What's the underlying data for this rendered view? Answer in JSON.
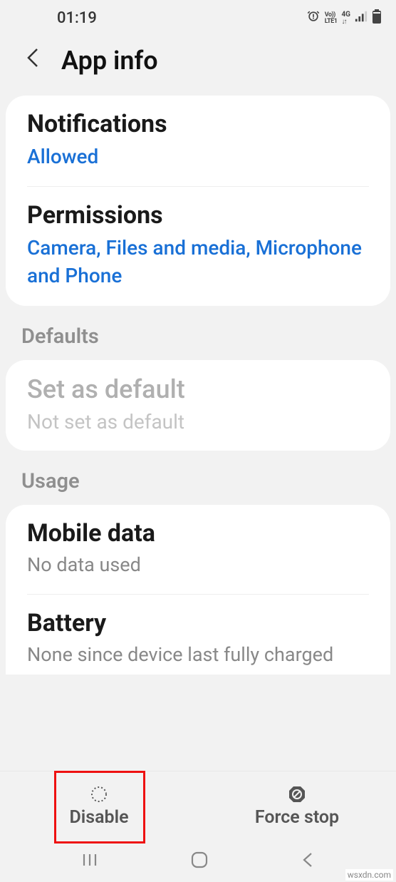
{
  "status": {
    "time": "01:19",
    "vo": "Vo))",
    "lte": "LTE1",
    "net": "4G"
  },
  "header": {
    "title": "App info"
  },
  "notifications": {
    "title": "Notifications",
    "value": "Allowed"
  },
  "permissions": {
    "title": "Permissions",
    "value": "Camera, Files and media, Microphone and Phone"
  },
  "sections": {
    "defaults": "Defaults",
    "usage": "Usage"
  },
  "defaults": {
    "title": "Set as default",
    "value": "Not set as default"
  },
  "mobiledata": {
    "title": "Mobile data",
    "value": "No data used"
  },
  "battery": {
    "title": "Battery",
    "value": "None since device last fully charged"
  },
  "actions": {
    "disable": "Disable",
    "forcestop": "Force stop"
  },
  "watermark": "wsxdn.com"
}
